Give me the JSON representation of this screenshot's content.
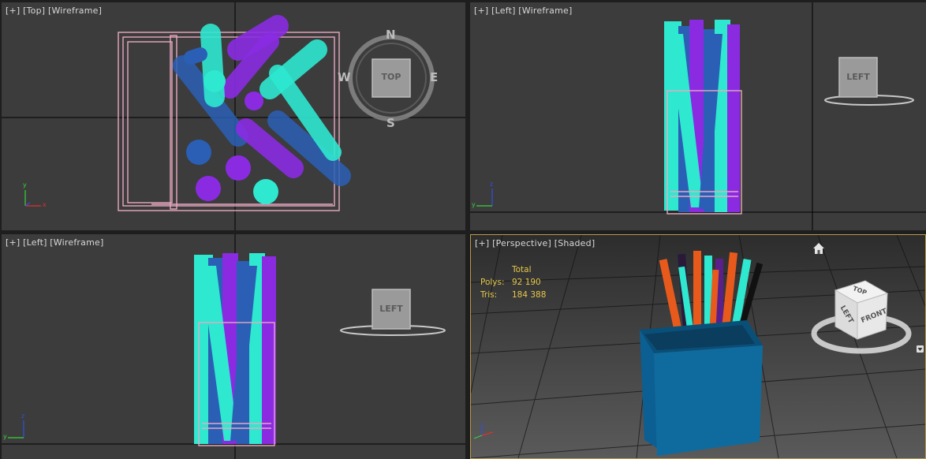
{
  "viewports": {
    "top": {
      "label_bracket": "[+]",
      "label_view": "[Top]",
      "label_mode": "[Wireframe]",
      "navcube_label": "TOP",
      "compass": {
        "n": "N",
        "s": "S",
        "e": "E",
        "w": "W"
      }
    },
    "left_a": {
      "label_bracket": "[+]",
      "label_view": "[Left]",
      "label_mode": "[Wireframe]",
      "navcube_label": "LEFT"
    },
    "left_b": {
      "label_bracket": "[+]",
      "label_view": "[Left]",
      "label_mode": "[Wireframe]",
      "navcube_label": "LEFT"
    },
    "perspective": {
      "label_bracket": "[+]",
      "label_view": "[Perspective]",
      "label_mode": "[Shaded]",
      "navcube": {
        "top": "TOP",
        "left": "LEFT",
        "front": "FRONT"
      }
    }
  },
  "stats": {
    "header": "Total",
    "polys_label": "Polys:",
    "polys_value": "92 190",
    "tris_label": "Tris:",
    "tris_value": "184 388"
  },
  "axis": {
    "x": "x",
    "y": "y",
    "z": "z"
  },
  "icons": {
    "home": "home-icon",
    "dropdown": "chevron-down-icon"
  },
  "colors": {
    "viewport_bg": "#3c3c3c",
    "grid_major": "#000000",
    "grid_minor": "#4a4a4a",
    "cyan": "#2ee8d0",
    "purple": "#8a2be2",
    "blue": "#2a5fb5",
    "pink": "#e8a8c0",
    "cup_blue": "#0f6b9e",
    "orange": "#e85a1c",
    "active_border": "#b89a4a",
    "stats_text": "#e6c84a"
  }
}
